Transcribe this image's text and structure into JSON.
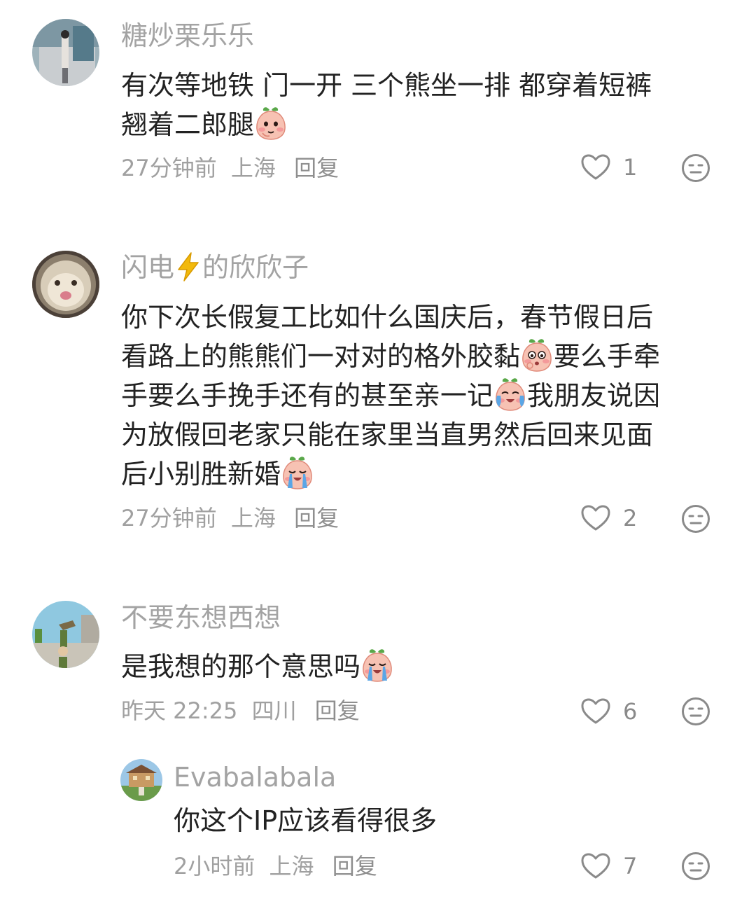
{
  "comments": [
    {
      "username": "糖炒栗乐乐",
      "text_1": "有次等地铁 门一开 三个熊坐一排 都穿着短裤",
      "text_2": "翘着二郎腿",
      "time": "27分钟前",
      "location": "上海",
      "reply_label": "回复",
      "likes": "1"
    },
    {
      "username_a": "闪电",
      "username_b": "的欣欣子",
      "lines": [
        "你下次长假复工比如什么国庆后，春节假日后",
        "看路上的熊熊们一对对的格外胶黏",
        "要么手牵",
        "手要么手挽手还有的甚至亲一记",
        "我朋友说因",
        "为放假回老家只能在家里当直男然后回来见面",
        "后小别胜新婚"
      ],
      "time": "27分钟前",
      "location": "上海",
      "reply_label": "回复",
      "likes": "2"
    },
    {
      "username": "不要东想西想",
      "text": "是我想的那个意思吗",
      "time": "昨天 22:25",
      "location": "四川",
      "reply_label": "回复",
      "likes": "6"
    }
  ],
  "reply": {
    "username": "Evabalabala",
    "text": "你这个IP应该看得很多",
    "time": "2小时前",
    "location": "上海",
    "reply_label": "回复",
    "likes": "7"
  },
  "icons": {
    "like": "heart-outline-icon",
    "dislike": "meh-face-icon",
    "emoji": "peach-face-emoji"
  },
  "colors": {
    "username": "#a3a3a3",
    "text": "#222222",
    "meta": "#a0a0a0",
    "icon": "#8a8a8a"
  }
}
